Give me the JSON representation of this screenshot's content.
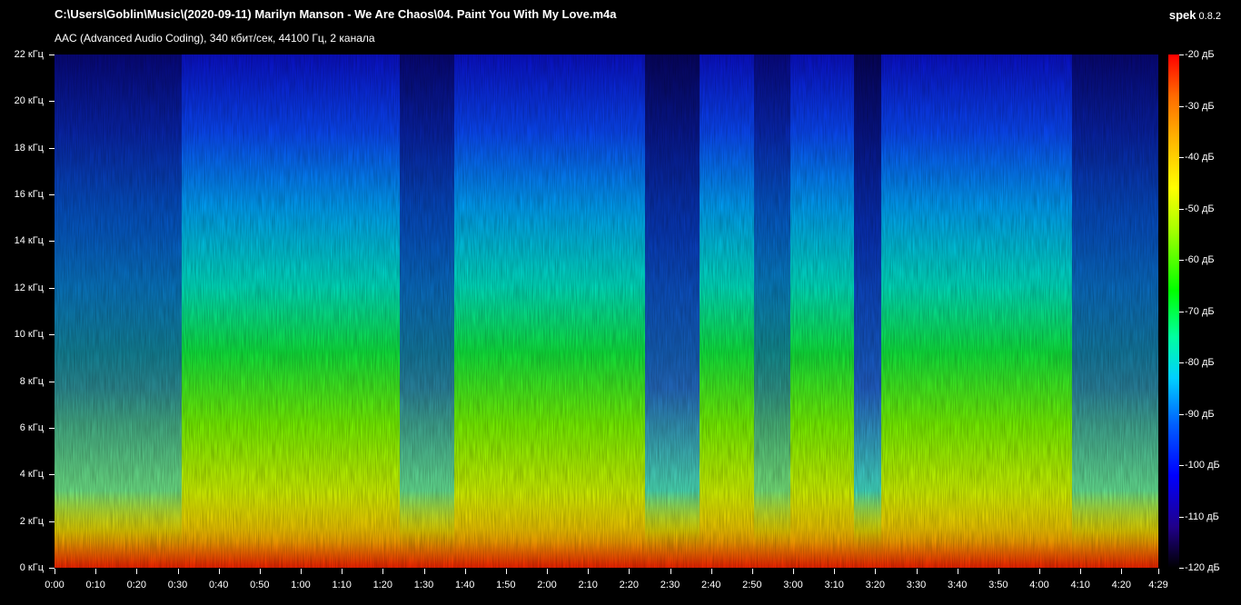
{
  "header": {
    "file_path": "C:\\Users\\Goblin\\Music\\(2020-09-11) Marilyn Manson - We Are Chaos\\04. Paint You With My Love.m4a",
    "audio_info": "AAC (Advanced Audio Coding), 340 кбит/сек, 44100 Гц, 2 канала",
    "app_name": "spek",
    "app_version": "0.8.2"
  },
  "spectrogram": {
    "description_icon": "spectrogram-image",
    "duration_label": "4:29"
  },
  "freq_axis": {
    "labels": [
      "22 кГц",
      "20 кГц",
      "18 кГц",
      "16 кГц",
      "14 кГц",
      "12 кГц",
      "10 кГц",
      "8 кГц",
      "6 кГц",
      "4 кГц",
      "2 кГц",
      "0 кГц"
    ]
  },
  "time_axis": {
    "labels": [
      "0:00",
      "0:10",
      "0:20",
      "0:30",
      "0:40",
      "0:50",
      "1:00",
      "1:10",
      "1:20",
      "1:30",
      "1:40",
      "1:50",
      "2:00",
      "2:10",
      "2:20",
      "2:30",
      "2:40",
      "2:50",
      "3:00",
      "3:10",
      "3:20",
      "3:30",
      "3:40",
      "3:50",
      "4:00",
      "4:10",
      "4:20",
      "4:29"
    ]
  },
  "db_axis": {
    "labels": [
      "-20 дБ",
      "-30 дБ",
      "-40 дБ",
      "-50 дБ",
      "-60 дБ",
      "-70 дБ",
      "-80 дБ",
      "-90 дБ",
      "-100 дБ",
      "-110 дБ",
      "-120 дБ"
    ]
  }
}
